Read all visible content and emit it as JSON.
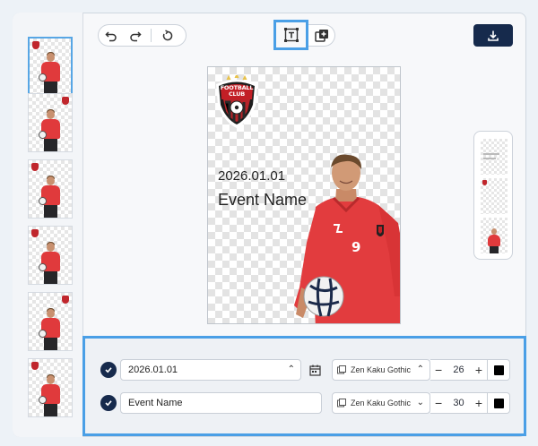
{
  "thumbnails": [
    {
      "crest": "left"
    },
    {
      "crest": "right"
    },
    {
      "crest": "left"
    },
    {
      "crest": "left"
    },
    {
      "crest": "right"
    },
    {
      "crest": "left"
    }
  ],
  "selected_thumbnail_index": 0,
  "card": {
    "crest_text": "FOOTBALL\nCLUB",
    "date": "2026.01.01",
    "event": "Event Name",
    "jersey_number": "9"
  },
  "rows": [
    {
      "text": "2026.01.01",
      "font": "Zen Kaku Gothic",
      "size": "26",
      "color": "#000000",
      "checked": true
    },
    {
      "text": "Event Name",
      "font": "Zen Kaku Gothic",
      "size": "30",
      "color": "#000000",
      "checked": true
    }
  ],
  "colors": {
    "accent": "#4a9fe6",
    "primary": "#162a4c",
    "jersey": "#e03a3c"
  },
  "icons": [
    "undo-icon",
    "redo-icon",
    "reset-icon",
    "text-frame-icon",
    "add-layer-icon",
    "download-icon",
    "calendar-icon",
    "font-icon",
    "check-icon"
  ]
}
